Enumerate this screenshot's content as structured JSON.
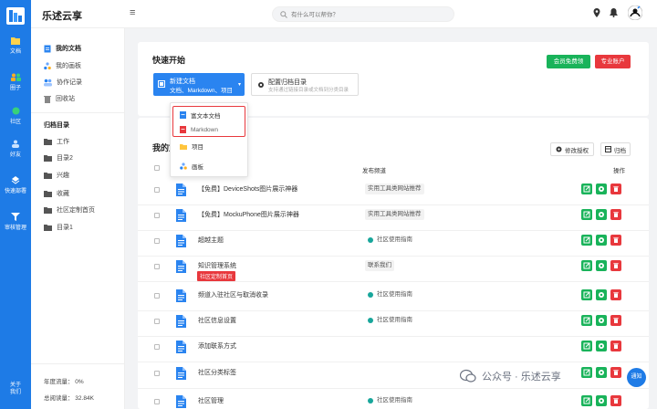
{
  "app": {
    "name": "乐述云享"
  },
  "search": {
    "placeholder": "有什么可以帮你？"
  },
  "rail": [
    {
      "label": "文档",
      "icon": "folder-icon"
    },
    {
      "label": "圈子",
      "icon": "group-icon"
    },
    {
      "label": "社区",
      "icon": "globe-icon"
    },
    {
      "label": "好友",
      "icon": "friends-icon"
    },
    {
      "label": "快速部署",
      "icon": "deploy-icon"
    },
    {
      "label": "审核管理",
      "icon": "filter-icon"
    },
    {
      "label": "关于我们",
      "icon": "info-icon"
    }
  ],
  "sidebar": {
    "items": [
      {
        "label": "我的文档"
      },
      {
        "label": "我的画板"
      },
      {
        "label": "协作记录"
      },
      {
        "label": "回收站"
      }
    ],
    "section_title": "归档目录",
    "folders": [
      {
        "label": "工作"
      },
      {
        "label": "目录2"
      },
      {
        "label": "兴趣"
      },
      {
        "label": "收藏"
      },
      {
        "label": "社区定制首页"
      },
      {
        "label": "目录1"
      }
    ],
    "stats": {
      "year_flow": "年度流量： 0%",
      "total_reads": "总阅读量： 32.84K"
    }
  },
  "quick_start": {
    "title": "快速开始",
    "member_button": "会员免费领",
    "pro_button": "专业账户",
    "new_doc": {
      "title": "新建文档",
      "subtitle": "文档、Markdown、项目"
    },
    "config": {
      "title": "配置归档目录",
      "subtitle": "支持通过链接目录或文档到分类目录"
    }
  },
  "dropdown": {
    "items": [
      {
        "label": "富文本文档"
      },
      {
        "label": "Markdown"
      },
      {
        "label": "项目"
      },
      {
        "label": "画板"
      }
    ]
  },
  "list": {
    "title": "我的文",
    "edit_perm_button": "修改授权",
    "archive_button": "归档",
    "col_channel": "发布频道",
    "col_ops": "操作",
    "rows": [
      {
        "name": "【免费】DeviceShots图片展示神器",
        "channel": "实用工具类网站推荐",
        "dot": false,
        "tag": ""
      },
      {
        "name": "【免费】MockuPhone图片展示神器",
        "channel": "实用工具类网站推荐",
        "dot": false,
        "tag": ""
      },
      {
        "name": "超越主题",
        "channel": "社区使用指南",
        "dot": true,
        "tag": ""
      },
      {
        "name": "知识管理系统",
        "channel": "联系我们",
        "dot": false,
        "tag": "社区定制首页"
      },
      {
        "name": "频道入驻社区与取消收录",
        "channel": "社区使用指南",
        "dot": true,
        "tag": ""
      },
      {
        "name": "社区信息设置",
        "channel": "社区使用指南",
        "dot": true,
        "tag": ""
      },
      {
        "name": "添加联系方式",
        "channel": "",
        "dot": false,
        "tag": ""
      },
      {
        "name": "社区分类标签",
        "channel": "",
        "dot": false,
        "tag": ""
      },
      {
        "name": "社区管理",
        "channel": "社区使用指南",
        "dot": true,
        "tag": ""
      }
    ]
  },
  "watermark": {
    "text": "公众号 · 乐述云享"
  },
  "fab": {
    "label": "通知"
  },
  "colors": {
    "primary": "#1e7be6",
    "green": "#19b35a",
    "red": "#e8383d",
    "teal": "#18a69b"
  }
}
